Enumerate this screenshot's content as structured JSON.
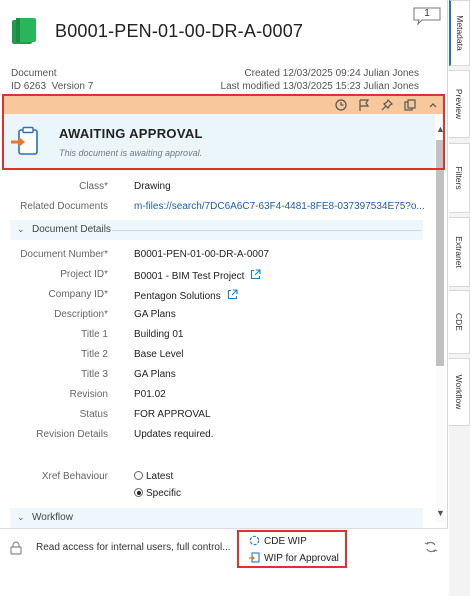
{
  "header": {
    "title": "B0001-PEN-01-00-DR-A-0007",
    "comment_count": "1"
  },
  "doc_info": {
    "type": "Document",
    "id_line": "ID 6263",
    "version_line": "Version 7",
    "created": "Created 12/03/2025 09:24 Julian Jones",
    "modified": "Last modified 13/03/2025 15:23 Julian Jones"
  },
  "workflow_state": {
    "title": "AWAITING APPROVAL",
    "description": "This document is awaiting approval.",
    "toolbar_icons": [
      "clock-icon",
      "flag-icon",
      "pin-icon",
      "copy-icon",
      "collapse-icon"
    ]
  },
  "properties_top": [
    {
      "label": "Class*",
      "value": "Drawing"
    },
    {
      "label": "Related Documents",
      "value": "m-files://search/7DC6A6C7-63F4-4481-8FE8-037397534E75?o..."
    }
  ],
  "sections": {
    "document_details": "Document Details",
    "workflow": "Workflow"
  },
  "properties": [
    {
      "label": "Document Number*",
      "value": "B0001-PEN-01-00-DR-A-0007"
    },
    {
      "label": "Project ID*",
      "value": "B0001 - BIM Test Project"
    },
    {
      "label": "Company ID*",
      "value": "Pentagon Solutions"
    },
    {
      "label": "Description*",
      "value": "GA Plans"
    },
    {
      "label": "Title 1",
      "value": "Building 01"
    },
    {
      "label": "Title 2",
      "value": "Base Level"
    },
    {
      "label": "Title 3",
      "value": "GA Plans"
    },
    {
      "label": "Revision",
      "value": "P01.02"
    },
    {
      "label": "Status",
      "value": "FOR APPROVAL"
    },
    {
      "label": "Revision Details",
      "value": "Updates required."
    }
  ],
  "xref": {
    "label": "Xref Behaviour",
    "options": [
      "Latest",
      "Specific"
    ],
    "selected": "Specific"
  },
  "footer": {
    "permissions": "Read access for internal users, full control...",
    "actions": [
      "CDE WIP",
      "WIP for Approval"
    ]
  },
  "tabs": [
    "Metadata",
    "Preview",
    "Filters",
    "Extranet",
    "CDE",
    "Workflow"
  ],
  "colors": {
    "accent": "#1b73c9",
    "workflow_bar": "#f7c89c",
    "workflow_panel": "#eaf6fc",
    "highlight": "#e03131",
    "doc_icon": "#1e9e4a"
  }
}
